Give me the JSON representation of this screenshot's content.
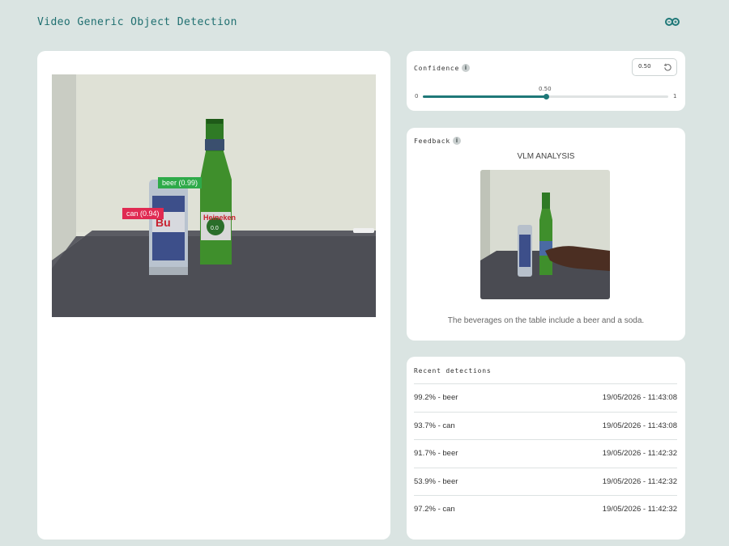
{
  "app": {
    "title": "Video Generic Object Detection",
    "logo_icon": "infinity-logo-icon",
    "accent_color": "#1f7878"
  },
  "video": {
    "detections": [
      {
        "label": "beer (0.99)",
        "color": "#2eaa49"
      },
      {
        "label": "can (0.94)",
        "color": "#e02a52"
      }
    ]
  },
  "confidence": {
    "label": "Confidence",
    "info_icon": "info-icon",
    "value_text": "0.50",
    "reset_icon": "reset-icon",
    "slider": {
      "min_label": "0",
      "max_label": "1",
      "current_label": "0.50",
      "value": 0.5
    }
  },
  "feedback": {
    "label": "Feedback",
    "info_icon": "info-icon",
    "vlm_title": "VLM ANALYSIS",
    "caption": "The beverages on the table include a beer and a soda."
  },
  "recent": {
    "label": "Recent detections",
    "rows": [
      {
        "text": "99.2% - beer",
        "time": "19/05/2026 - 11:43:08"
      },
      {
        "text": "93.7% - can",
        "time": "19/05/2026 - 11:43:08"
      },
      {
        "text": "91.7% - beer",
        "time": "19/05/2026 - 11:42:32"
      },
      {
        "text": "53.9% - beer",
        "time": "19/05/2026 - 11:42:32"
      },
      {
        "text": "97.2% - can",
        "time": "19/05/2026 - 11:42:32"
      }
    ]
  }
}
